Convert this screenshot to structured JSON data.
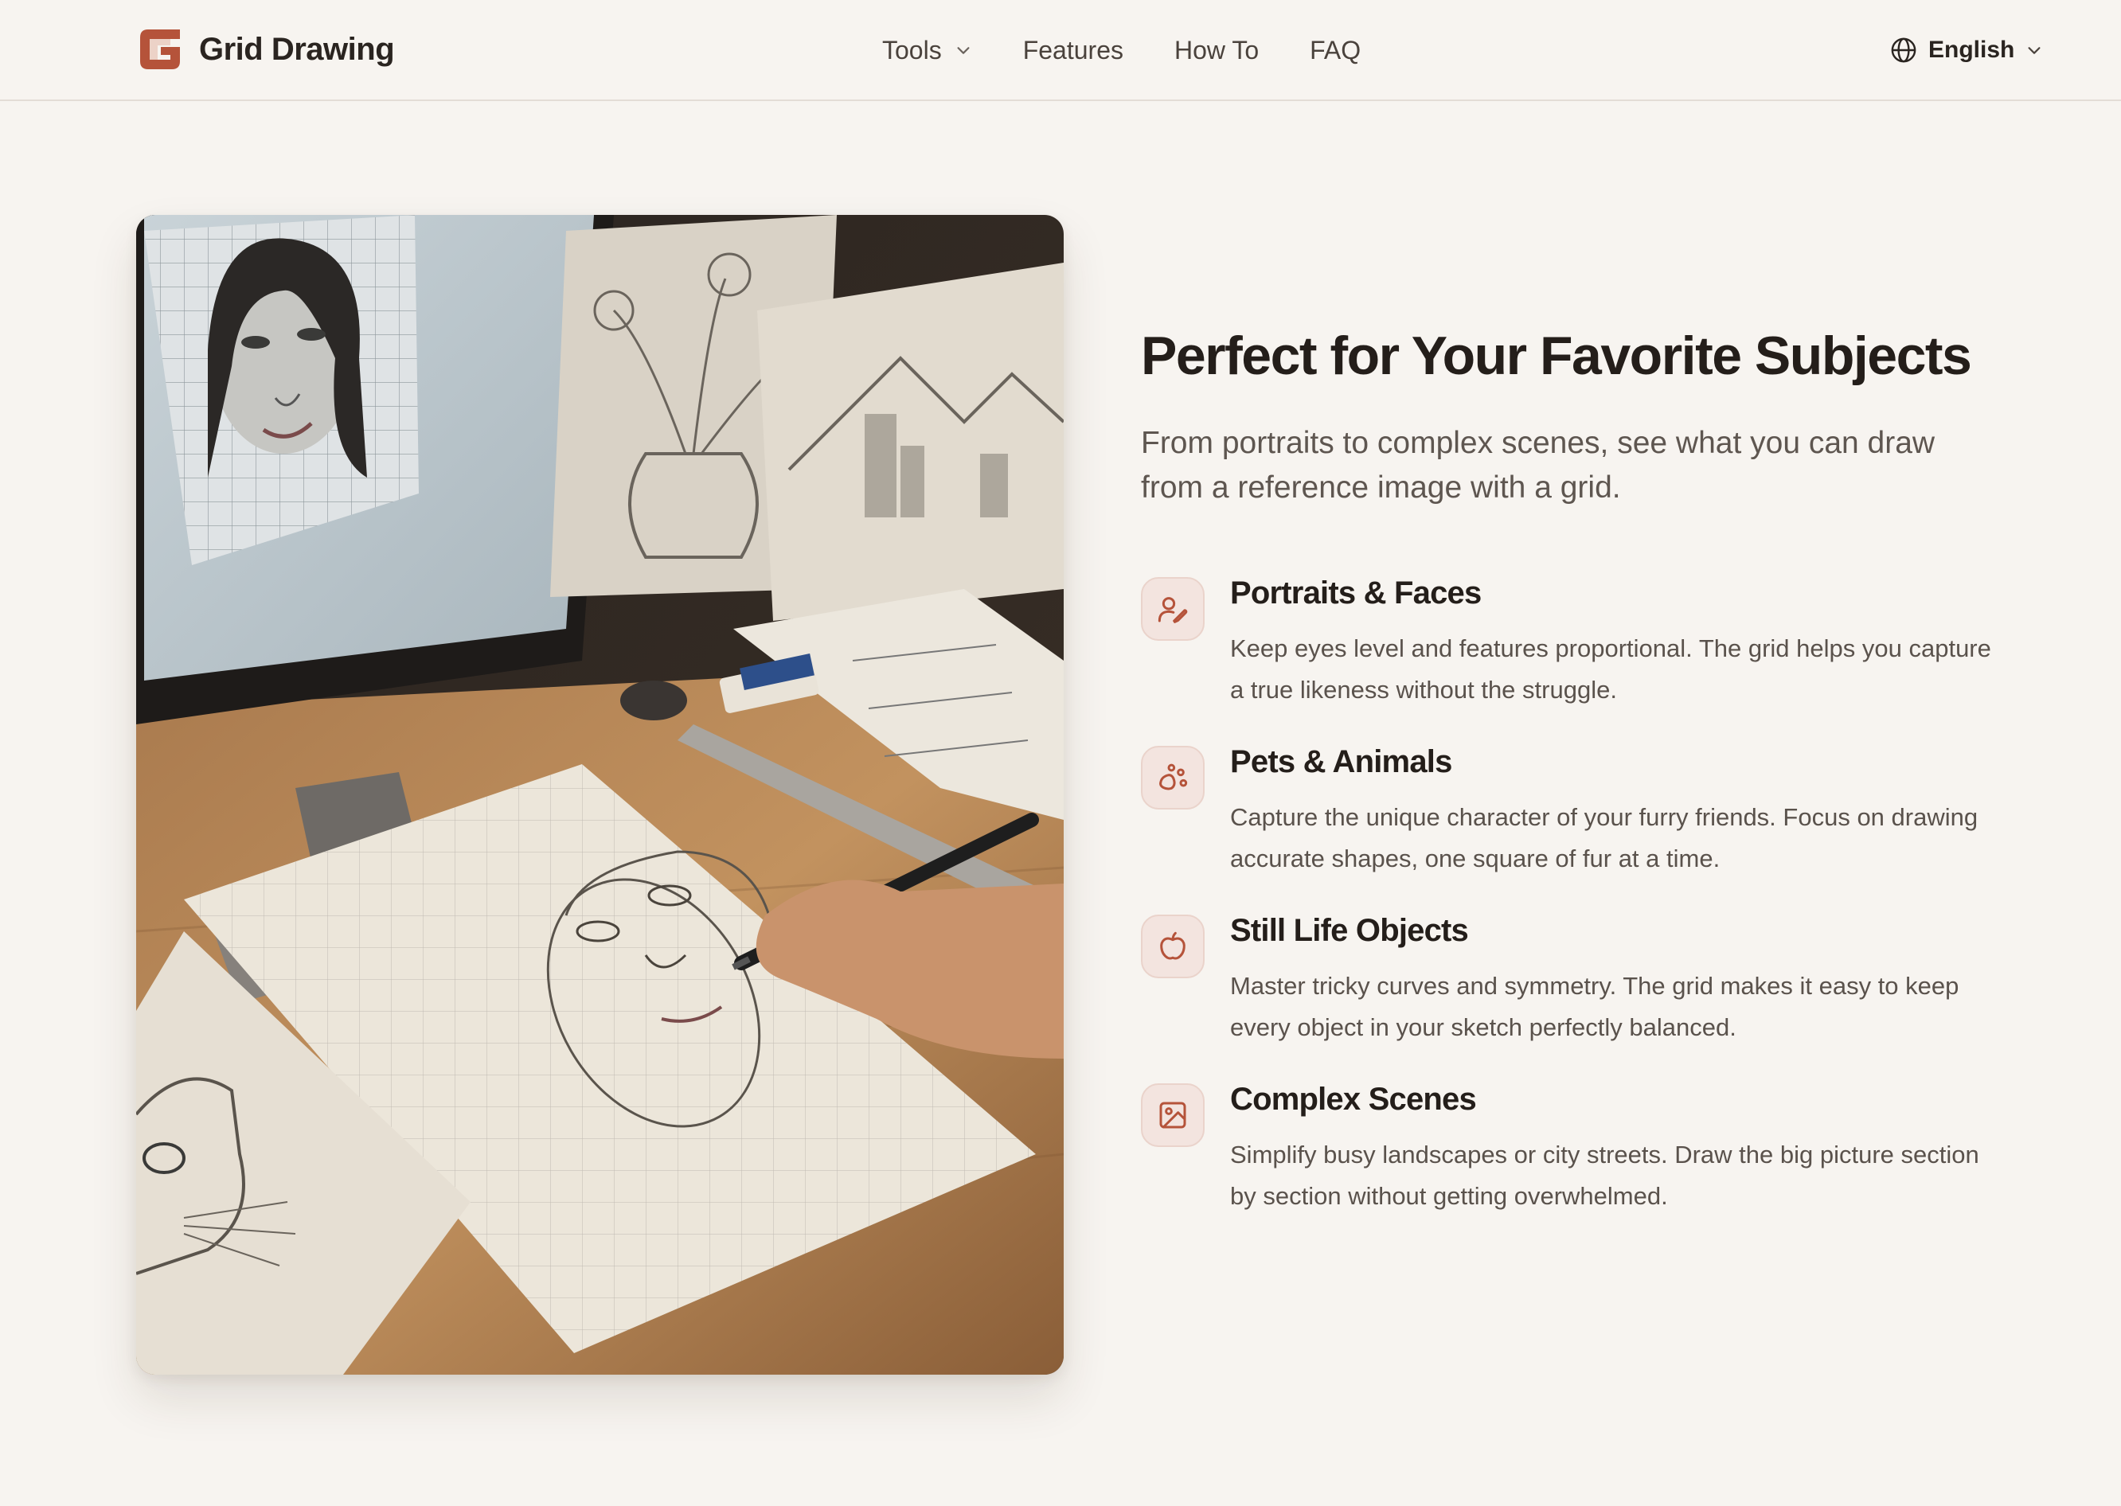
{
  "brand": {
    "name": "Grid Drawing",
    "accent": "#b5533a"
  },
  "nav": {
    "items": [
      {
        "label": "Tools",
        "dropdown": true
      },
      {
        "label": "Features"
      },
      {
        "label": "How To"
      },
      {
        "label": "FAQ"
      }
    ]
  },
  "language": {
    "label": "English",
    "icon": "globe-icon"
  },
  "hero_image": {
    "alt": "Hand drawing a portrait on grid paper at a desk"
  },
  "section": {
    "title": "Perfect for Your Favorite Subjects",
    "subtitle": "From portraits to complex scenes, see what you can draw from a reference image with a grid."
  },
  "features": [
    {
      "icon": "user-pen-icon",
      "title": "Portraits & Faces",
      "text": "Keep eyes level and features proportional. The grid helps you capture a true likeness without the struggle."
    },
    {
      "icon": "paw-icon",
      "title": "Pets & Animals",
      "text": "Capture the unique character of your furry friends. Focus on drawing accurate shapes, one square of fur at a time."
    },
    {
      "icon": "apple-icon",
      "title": "Still Life Objects",
      "text": "Master tricky curves and symmetry. The grid makes it easy to keep every object in your sketch perfectly balanced."
    },
    {
      "icon": "image-icon",
      "title": "Complex Scenes",
      "text": "Simplify busy landscapes or city streets. Draw the big picture section by section without getting overwhelmed."
    }
  ]
}
